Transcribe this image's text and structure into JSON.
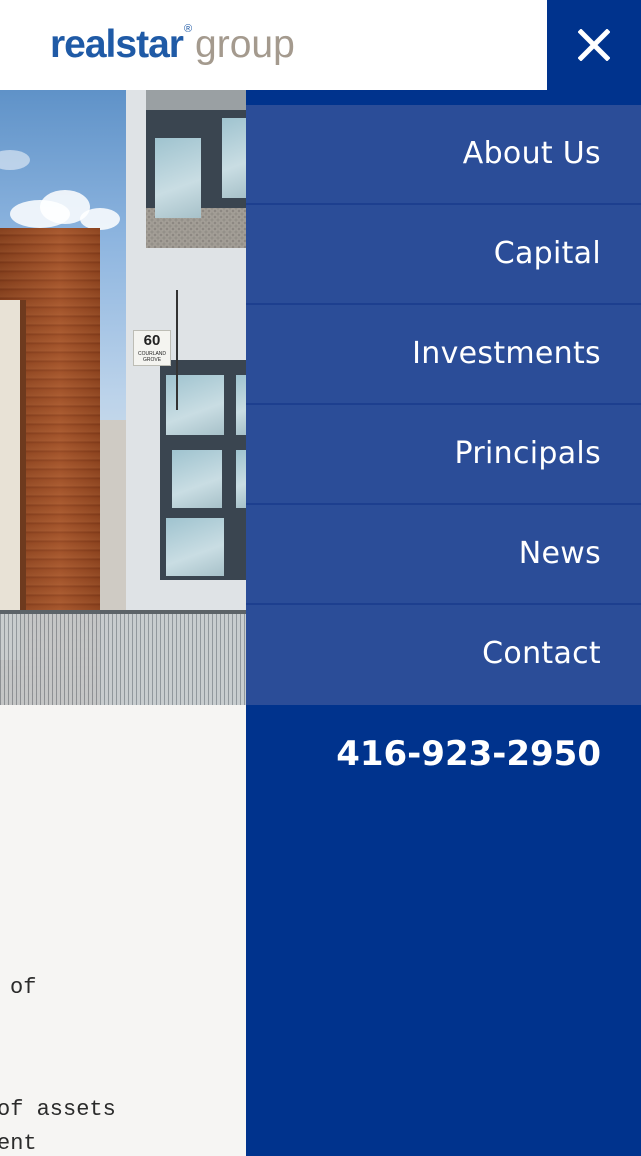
{
  "header": {
    "logo_main": "realstar",
    "logo_registered": "®",
    "logo_sub": "group",
    "close_icon": "close-icon"
  },
  "hero": {
    "building_number": "60",
    "building_street": "COURLAND GROVE"
  },
  "nav": {
    "items": [
      {
        "label": "About Us"
      },
      {
        "label": "Capital"
      },
      {
        "label": "Investments"
      },
      {
        "label": "Principals"
      },
      {
        "label": "News"
      },
      {
        "label": "Contact"
      }
    ],
    "phone": "416-923-2950"
  },
  "body": {
    "lines": [
      "of",
      "of assets",
      "ent"
    ]
  },
  "colors": {
    "brand_blue": "#00338d",
    "menu_item": "#2b4d98",
    "logo_blue": "#1f5aa6",
    "logo_grey": "#a49a8e"
  }
}
